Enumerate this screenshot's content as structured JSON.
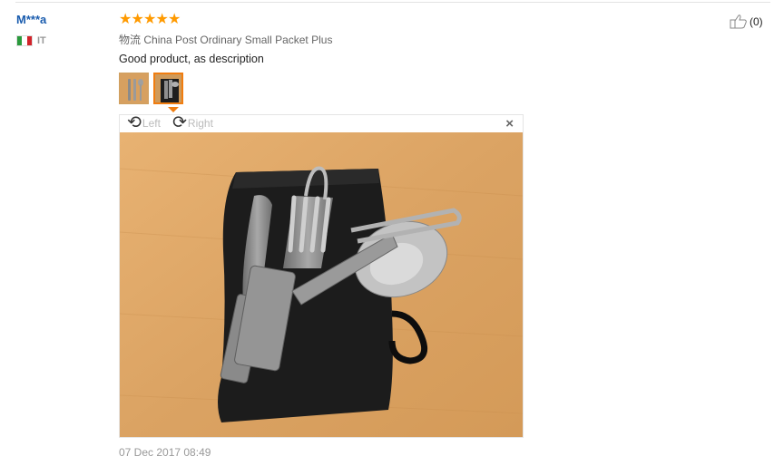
{
  "review": {
    "buyer_name": "M***a",
    "country_code": "IT",
    "rating": 5,
    "shipping_cn": "物流",
    "shipping_method": "China Post Ordinary Small Packet Plus",
    "text": "Good product, as description",
    "like_count": "(0)",
    "date": "07 Dec 2017 08:49"
  },
  "viewer": {
    "rotate_left_label": "Left",
    "rotate_right_label": "Right",
    "close_symbol": "×"
  },
  "colors": {
    "star": "#ff9a00",
    "name": "#1a5cae",
    "thumb_active_border": "#f07d10"
  },
  "icons": [
    "star-icon",
    "rotate-left-icon",
    "rotate-right-icon",
    "close-icon",
    "thumbs-up-icon",
    "flag-it-icon"
  ]
}
